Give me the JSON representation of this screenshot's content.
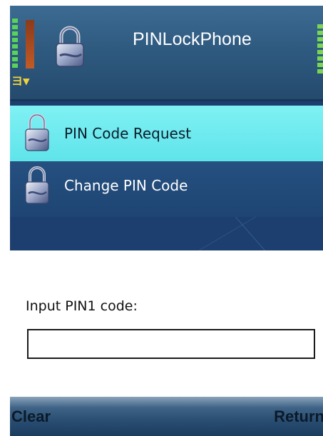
{
  "header": {
    "app_title": "PINLockPhone",
    "icon": "padlock-icon"
  },
  "status": {
    "signal_icon": "signal-strength-icon",
    "battery_icon": "battery-icon",
    "indicator_glyph": "ヨ▼"
  },
  "menu": {
    "items": [
      {
        "label": "PIN Code Request",
        "icon": "padlock-icon",
        "selected": true
      },
      {
        "label": "Change PIN Code",
        "icon": "padlock-icon",
        "selected": false
      }
    ]
  },
  "dialog": {
    "prompt": "Input PIN1 code:",
    "input_value": ""
  },
  "softkeys": {
    "left": "Clear",
    "right": "Return"
  },
  "colors": {
    "header_bg": "#2f5a80",
    "selected_item_bg": "#6aeaef",
    "menu_bg": "#1e4574",
    "softkey_text": "#0b1a2a"
  }
}
